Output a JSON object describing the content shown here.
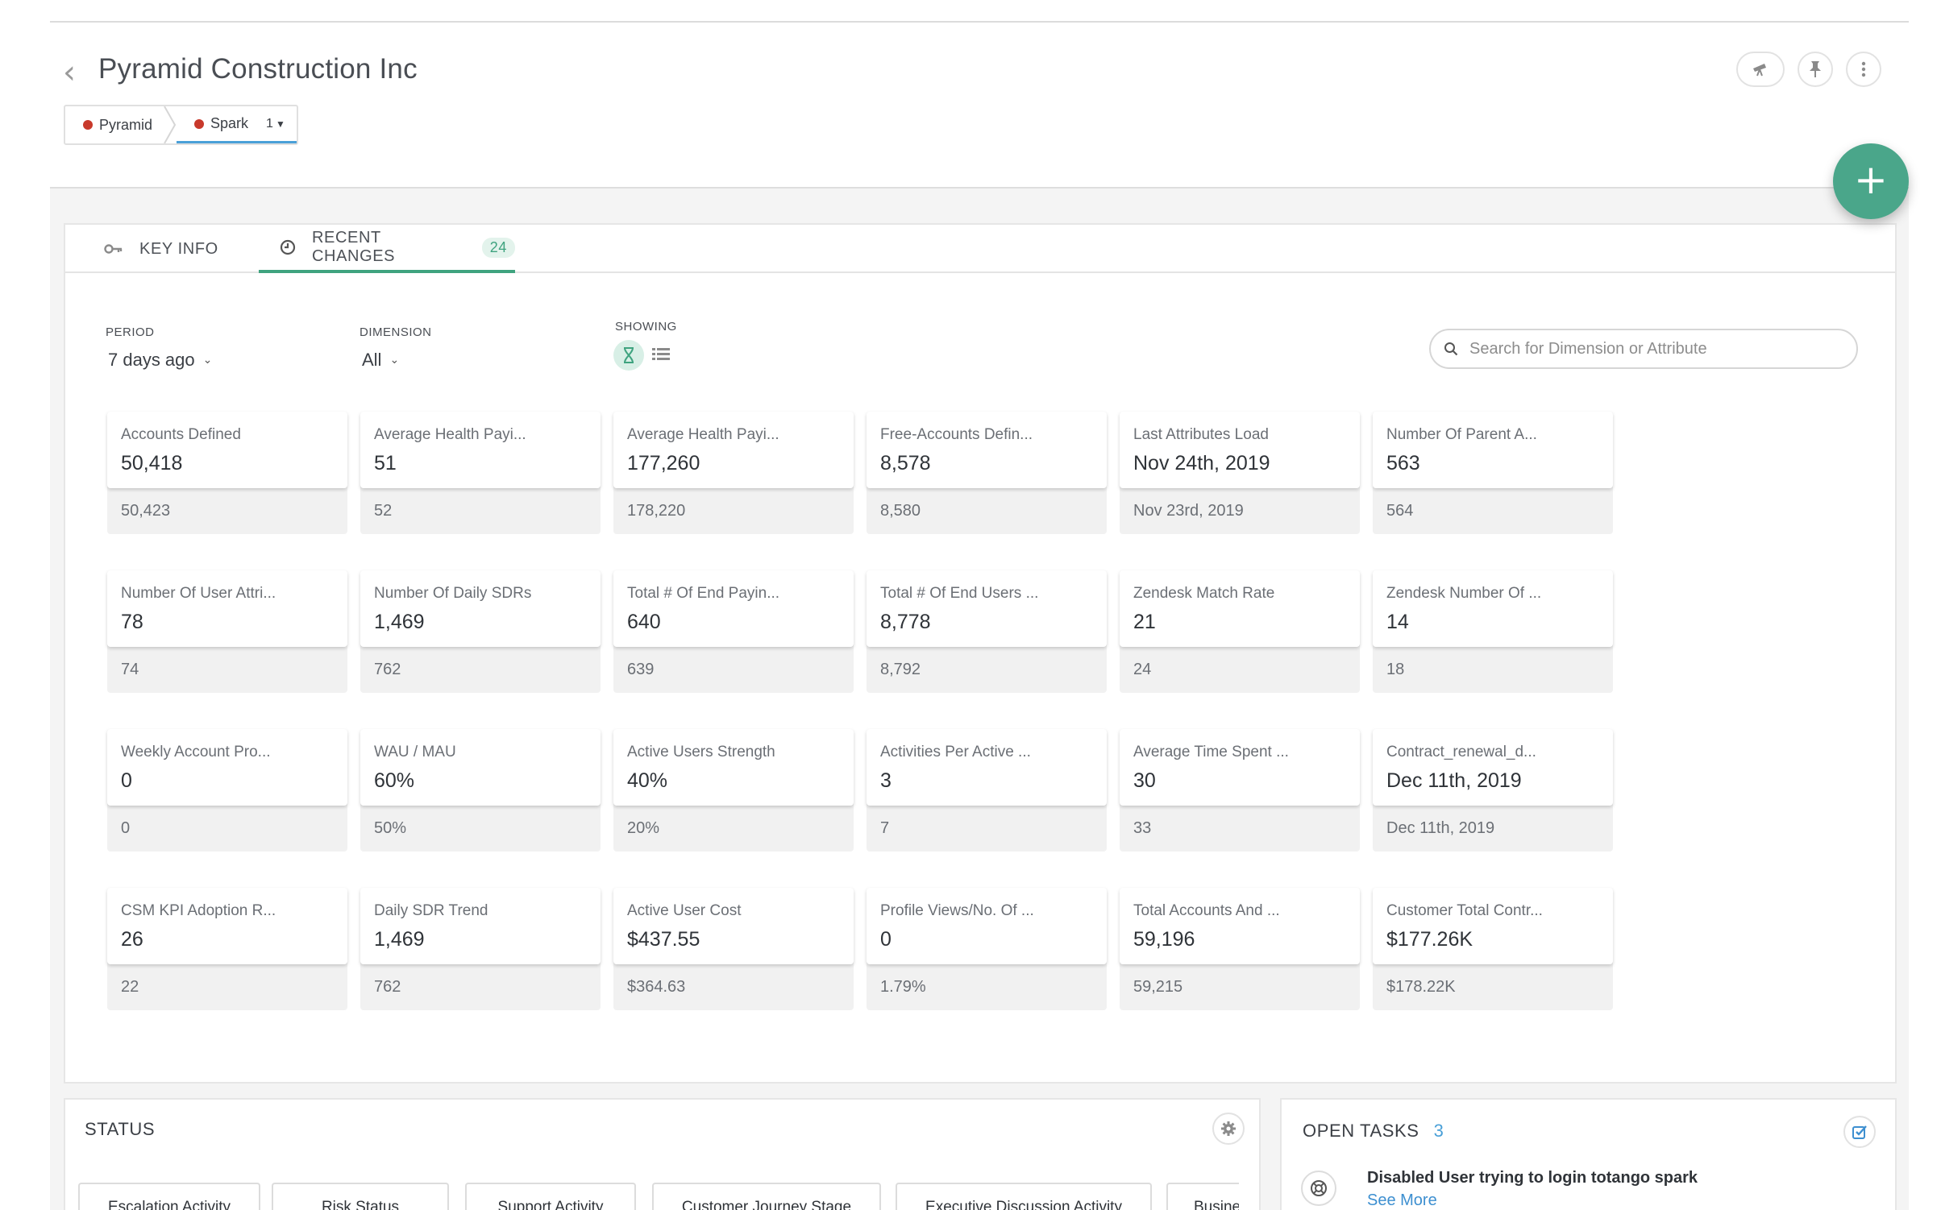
{
  "header": {
    "title": "Pyramid Construction Inc",
    "breadcrumb": [
      {
        "label": "Pyramid"
      },
      {
        "label": "Spark",
        "count": "1"
      }
    ]
  },
  "tabs": [
    {
      "label": "KEY INFO"
    },
    {
      "label": "RECENT CHANGES",
      "badge": "24"
    }
  ],
  "filters": {
    "period_label": "PERIOD",
    "period_value": "7 days ago",
    "dimension_label": "DIMENSION",
    "dimension_value": "All",
    "showing_label": "SHOWING"
  },
  "search": {
    "placeholder": "Search for Dimension or Attribute"
  },
  "metrics": [
    {
      "label": "Accounts Defined",
      "value": "50,418",
      "previous": "50,423"
    },
    {
      "label": "Average Health Payi...",
      "value": "51",
      "previous": "52"
    },
    {
      "label": "Average Health Payi...",
      "value": "177,260",
      "previous": "178,220"
    },
    {
      "label": "Free-Accounts Defin...",
      "value": "8,578",
      "previous": "8,580"
    },
    {
      "label": "Last Attributes Load",
      "value": "Nov 24th, 2019",
      "previous": "Nov 23rd, 2019"
    },
    {
      "label": "Number Of Parent A...",
      "value": "563",
      "previous": "564"
    },
    {
      "label": "Number Of User Attri...",
      "value": "78",
      "previous": "74"
    },
    {
      "label": "Number Of Daily SDRs",
      "value": "1,469",
      "previous": "762"
    },
    {
      "label": "Total # Of End Payin...",
      "value": "640",
      "previous": "639"
    },
    {
      "label": "Total # Of End Users ...",
      "value": "8,778",
      "previous": "8,792"
    },
    {
      "label": "Zendesk Match Rate",
      "value": "21",
      "previous": "24"
    },
    {
      "label": "Zendesk Number Of ...",
      "value": "14",
      "previous": "18"
    },
    {
      "label": "Weekly Account Pro...",
      "value": "0",
      "previous": "0"
    },
    {
      "label": "WAU / MAU",
      "value": "60%",
      "previous": "50%"
    },
    {
      "label": "Active Users Strength",
      "value": "40%",
      "previous": "20%"
    },
    {
      "label": "Activities Per Active ...",
      "value": "3",
      "previous": "7"
    },
    {
      "label": "Average Time Spent ...",
      "value": "30",
      "previous": "33"
    },
    {
      "label": "Contract_renewal_d...",
      "value": "Dec 11th, 2019",
      "previous": "Dec 11th, 2019"
    },
    {
      "label": "CSM KPI Adoption R...",
      "value": "26",
      "previous": "22"
    },
    {
      "label": "Daily SDR Trend",
      "value": "1,469",
      "previous": "762"
    },
    {
      "label": "Active User Cost",
      "value": "$437.55",
      "previous": "$364.63"
    },
    {
      "label": "Profile Views/No. Of ...",
      "value": "0",
      "previous": "1.79%"
    },
    {
      "label": "Total Accounts And ...",
      "value": "59,196",
      "previous": "59,215"
    },
    {
      "label": "Customer Total Contr...",
      "value": "$177.26K",
      "previous": "$178.22K"
    }
  ],
  "status": {
    "title": "STATUS",
    "pills": [
      {
        "label": "Escalation Activity"
      },
      {
        "label": "Risk Status"
      },
      {
        "label": "Support Activity"
      },
      {
        "label": "Customer Journey Stage"
      },
      {
        "label": "Executive Discussion Activity"
      },
      {
        "label": "Busines"
      }
    ]
  },
  "tasks": {
    "title": "OPEN TASKS",
    "count": "3",
    "first_task": "Disabled User trying to login totango spark",
    "see_more": "See More"
  },
  "colors": {
    "accent_green": "#3fa37f",
    "fab_green": "#4aa68a",
    "link_blue": "#3d8fd0",
    "breadcrumb_dot": "#c8392b"
  }
}
